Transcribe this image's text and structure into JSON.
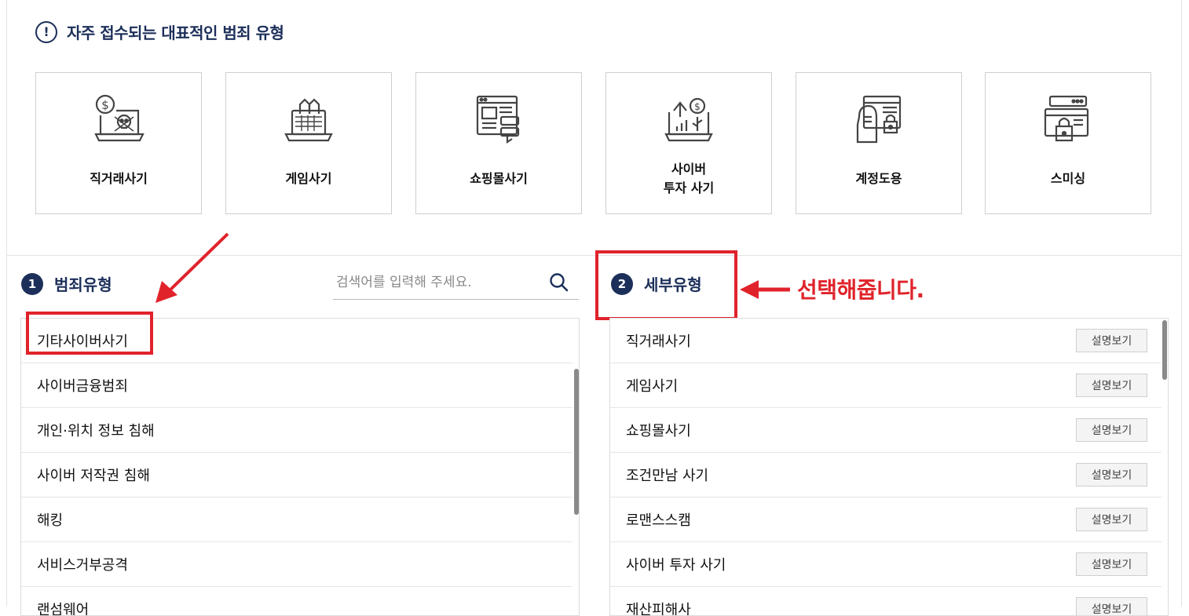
{
  "header": {
    "title": "자주 접수되는 대표적인 범죄 유형",
    "info_icon": "!"
  },
  "cards": [
    {
      "label": "직거래사기",
      "icon": "dollar-laptop-skull-icon"
    },
    {
      "label": "게임사기",
      "icon": "game-laptop-icon"
    },
    {
      "label": "쇼핑몰사기",
      "icon": "shopping-web-icon"
    },
    {
      "label": "사이버\n투자 사기",
      "icon": "investment-growth-icon"
    },
    {
      "label": "계정도용",
      "icon": "hacker-lock-icon"
    },
    {
      "label": "스미싱",
      "icon": "browser-lock-icon"
    }
  ],
  "crime_type": {
    "number": "1",
    "title": "범죄유형",
    "search_placeholder": "검색어를 입력해 주세요.",
    "items": [
      "기타사이버사기",
      "사이버금융범죄",
      "개인·위치 정보 침해",
      "사이버 저작권 침해",
      "해킹",
      "서비스거부공격",
      "랜섬웨어"
    ]
  },
  "sub_type": {
    "number": "2",
    "title": "세부유형",
    "desc_button": "설명보기",
    "items": [
      "직거래사기",
      "게임사기",
      "쇼핑몰사기",
      "조건만남 사기",
      "로맨스스캠",
      "사이버 투자 사기",
      "재산피해사"
    ]
  },
  "annotation": {
    "text": "선택해줍니다.",
    "color": "#e0232b"
  },
  "colors": {
    "navy": "#1c2f5a",
    "red": "#e0232b"
  }
}
